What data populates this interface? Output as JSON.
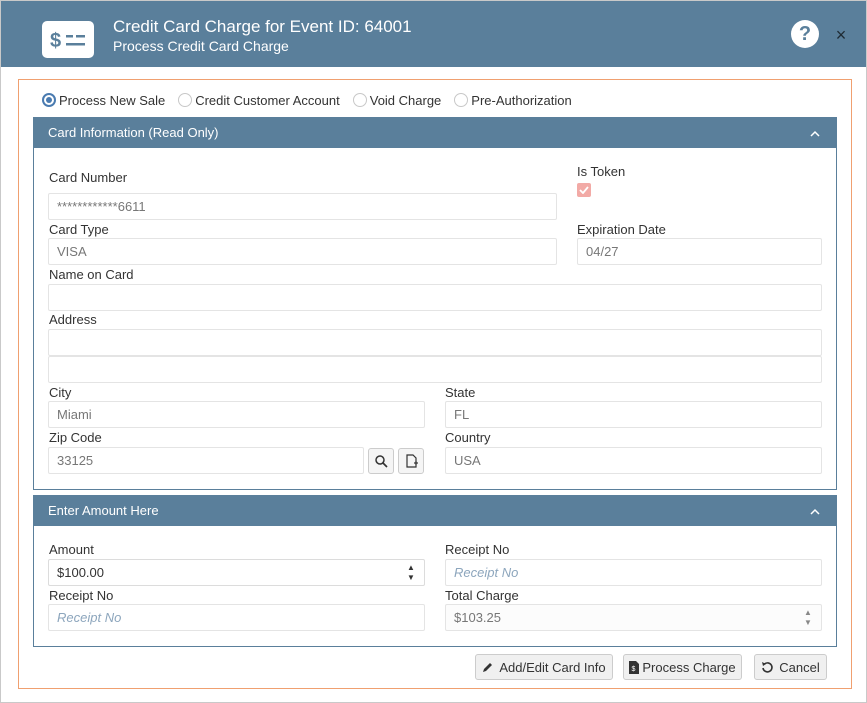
{
  "header": {
    "title": "Credit Card Charge for Event ID: 64001",
    "subtitle": "Process Credit Card Charge",
    "help_label": "?",
    "close_label": "×"
  },
  "modes": [
    {
      "label": "Process New Sale",
      "selected": true
    },
    {
      "label": "Credit Customer Account",
      "selected": false
    },
    {
      "label": "Void Charge",
      "selected": false
    },
    {
      "label": "Pre-Authorization",
      "selected": false
    }
  ],
  "card_panel": {
    "title": "Card Information (Read Only)",
    "card_number_label": "Card Number",
    "card_number": "************6611",
    "is_token_label": "Is Token",
    "is_token_checked": true,
    "card_type_label": "Card Type",
    "card_type": "VISA",
    "expiration_label": "Expiration Date",
    "expiration": "04/27",
    "name_label": "Name on Card",
    "name": "",
    "address_label": "Address",
    "address_line1": "",
    "address_line2": "",
    "city_label": "City",
    "city": "Miami",
    "state_label": "State",
    "state": "FL",
    "zip_label": "Zip Code",
    "zip": "33125",
    "country_label": "Country",
    "country": "USA"
  },
  "amount_panel": {
    "title": "Enter Amount Here",
    "amount_label": "Amount",
    "amount": "$100.00",
    "receipt_label_right": "Receipt No",
    "receipt_placeholder_right": "Receipt No",
    "receipt_label_left": "Receipt No",
    "receipt_placeholder_left": "Receipt No",
    "total_label": "Total Charge",
    "total": "$103.25"
  },
  "actions": {
    "add_edit": "Add/Edit Card Info",
    "process": "Process Charge",
    "cancel": "Cancel"
  },
  "colors": {
    "header": "#5a7f9b",
    "frame": "#f0a070",
    "radio_selected": "#4a7bb0",
    "checkbox": "#f2aaa6"
  }
}
